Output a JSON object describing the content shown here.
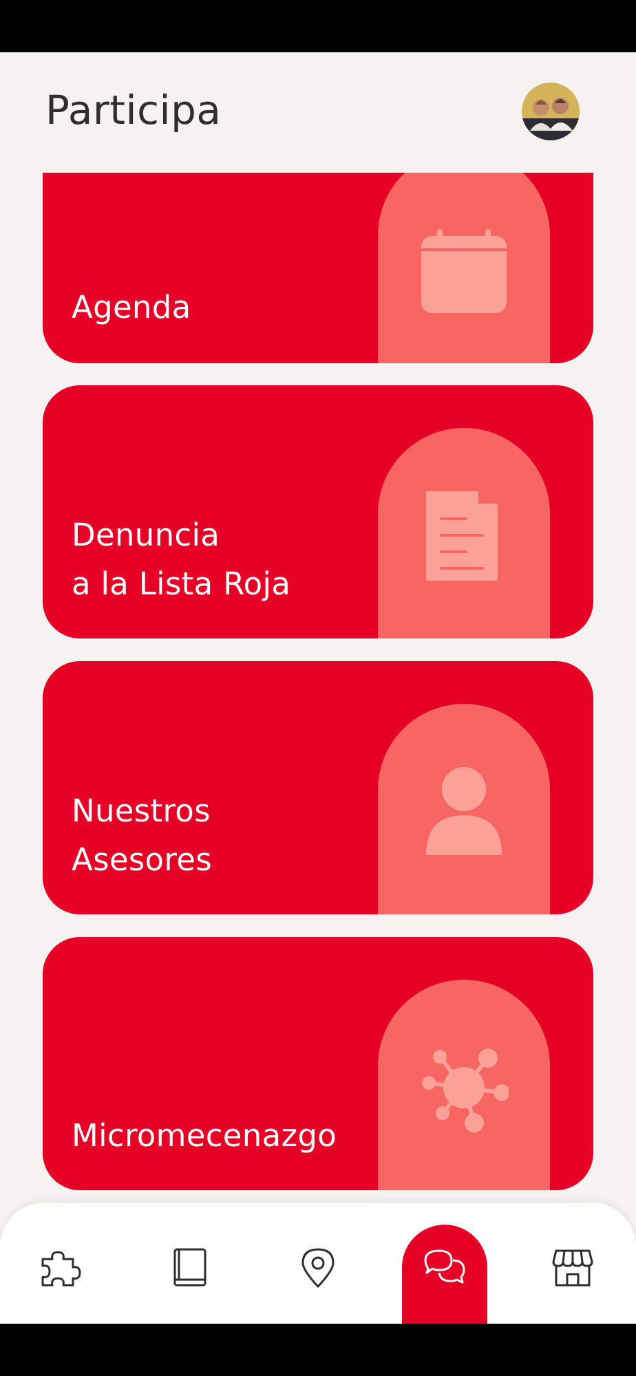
{
  "header": {
    "title": "Participa",
    "avatar_alt": "avatar"
  },
  "cards": [
    {
      "line1": "Agenda",
      "line2": "",
      "icon": "calendar-icon"
    },
    {
      "line1": "Denuncia",
      "line2": "a la Lista Roja",
      "icon": "document-icon"
    },
    {
      "line1": "Nuestros",
      "line2": "Asesores",
      "icon": "person-icon"
    },
    {
      "line1": "Micromecenazgo",
      "line2": "",
      "icon": "network-icon"
    }
  ],
  "nav": {
    "items": [
      {
        "icon": "puzzle-icon",
        "active": false
      },
      {
        "icon": "book-icon",
        "active": false
      },
      {
        "icon": "location-pin-icon",
        "active": false
      },
      {
        "icon": "chat-bubbles-icon",
        "active": true
      },
      {
        "icon": "store-icon",
        "active": false
      }
    ]
  },
  "colors": {
    "brand_red": "#e60026",
    "arch_salmon": "#f76662",
    "icon_fill": "#fba197",
    "background": "#f6f2f1",
    "title_text": "#2e2e2e"
  }
}
